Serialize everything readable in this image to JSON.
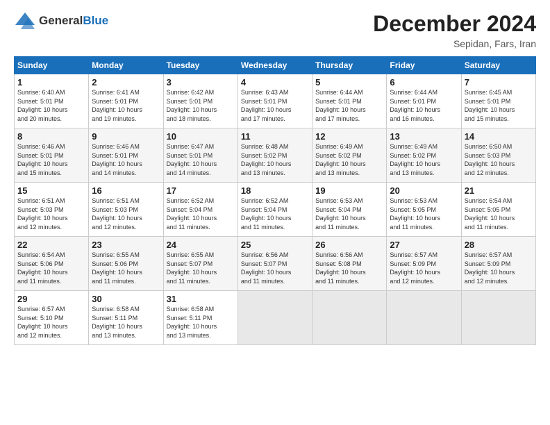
{
  "header": {
    "logo_general": "General",
    "logo_blue": "Blue",
    "month": "December 2024",
    "location": "Sepidan, Fars, Iran"
  },
  "days_of_week": [
    "Sunday",
    "Monday",
    "Tuesday",
    "Wednesday",
    "Thursday",
    "Friday",
    "Saturday"
  ],
  "weeks": [
    [
      {
        "day": "1",
        "info": "Sunrise: 6:40 AM\nSunset: 5:01 PM\nDaylight: 10 hours\nand 20 minutes."
      },
      {
        "day": "2",
        "info": "Sunrise: 6:41 AM\nSunset: 5:01 PM\nDaylight: 10 hours\nand 19 minutes."
      },
      {
        "day": "3",
        "info": "Sunrise: 6:42 AM\nSunset: 5:01 PM\nDaylight: 10 hours\nand 18 minutes."
      },
      {
        "day": "4",
        "info": "Sunrise: 6:43 AM\nSunset: 5:01 PM\nDaylight: 10 hours\nand 17 minutes."
      },
      {
        "day": "5",
        "info": "Sunrise: 6:44 AM\nSunset: 5:01 PM\nDaylight: 10 hours\nand 17 minutes."
      },
      {
        "day": "6",
        "info": "Sunrise: 6:44 AM\nSunset: 5:01 PM\nDaylight: 10 hours\nand 16 minutes."
      },
      {
        "day": "7",
        "info": "Sunrise: 6:45 AM\nSunset: 5:01 PM\nDaylight: 10 hours\nand 15 minutes."
      }
    ],
    [
      {
        "day": "8",
        "info": "Sunrise: 6:46 AM\nSunset: 5:01 PM\nDaylight: 10 hours\nand 15 minutes."
      },
      {
        "day": "9",
        "info": "Sunrise: 6:46 AM\nSunset: 5:01 PM\nDaylight: 10 hours\nand 14 minutes."
      },
      {
        "day": "10",
        "info": "Sunrise: 6:47 AM\nSunset: 5:01 PM\nDaylight: 10 hours\nand 14 minutes."
      },
      {
        "day": "11",
        "info": "Sunrise: 6:48 AM\nSunset: 5:02 PM\nDaylight: 10 hours\nand 13 minutes."
      },
      {
        "day": "12",
        "info": "Sunrise: 6:49 AM\nSunset: 5:02 PM\nDaylight: 10 hours\nand 13 minutes."
      },
      {
        "day": "13",
        "info": "Sunrise: 6:49 AM\nSunset: 5:02 PM\nDaylight: 10 hours\nand 13 minutes."
      },
      {
        "day": "14",
        "info": "Sunrise: 6:50 AM\nSunset: 5:03 PM\nDaylight: 10 hours\nand 12 minutes."
      }
    ],
    [
      {
        "day": "15",
        "info": "Sunrise: 6:51 AM\nSunset: 5:03 PM\nDaylight: 10 hours\nand 12 minutes."
      },
      {
        "day": "16",
        "info": "Sunrise: 6:51 AM\nSunset: 5:03 PM\nDaylight: 10 hours\nand 12 minutes."
      },
      {
        "day": "17",
        "info": "Sunrise: 6:52 AM\nSunset: 5:04 PM\nDaylight: 10 hours\nand 11 minutes."
      },
      {
        "day": "18",
        "info": "Sunrise: 6:52 AM\nSunset: 5:04 PM\nDaylight: 10 hours\nand 11 minutes."
      },
      {
        "day": "19",
        "info": "Sunrise: 6:53 AM\nSunset: 5:04 PM\nDaylight: 10 hours\nand 11 minutes."
      },
      {
        "day": "20",
        "info": "Sunrise: 6:53 AM\nSunset: 5:05 PM\nDaylight: 10 hours\nand 11 minutes."
      },
      {
        "day": "21",
        "info": "Sunrise: 6:54 AM\nSunset: 5:05 PM\nDaylight: 10 hours\nand 11 minutes."
      }
    ],
    [
      {
        "day": "22",
        "info": "Sunrise: 6:54 AM\nSunset: 5:06 PM\nDaylight: 10 hours\nand 11 minutes."
      },
      {
        "day": "23",
        "info": "Sunrise: 6:55 AM\nSunset: 5:06 PM\nDaylight: 10 hours\nand 11 minutes."
      },
      {
        "day": "24",
        "info": "Sunrise: 6:55 AM\nSunset: 5:07 PM\nDaylight: 10 hours\nand 11 minutes."
      },
      {
        "day": "25",
        "info": "Sunrise: 6:56 AM\nSunset: 5:07 PM\nDaylight: 10 hours\nand 11 minutes."
      },
      {
        "day": "26",
        "info": "Sunrise: 6:56 AM\nSunset: 5:08 PM\nDaylight: 10 hours\nand 11 minutes."
      },
      {
        "day": "27",
        "info": "Sunrise: 6:57 AM\nSunset: 5:09 PM\nDaylight: 10 hours\nand 12 minutes."
      },
      {
        "day": "28",
        "info": "Sunrise: 6:57 AM\nSunset: 5:09 PM\nDaylight: 10 hours\nand 12 minutes."
      }
    ],
    [
      {
        "day": "29",
        "info": "Sunrise: 6:57 AM\nSunset: 5:10 PM\nDaylight: 10 hours\nand 12 minutes."
      },
      {
        "day": "30",
        "info": "Sunrise: 6:58 AM\nSunset: 5:11 PM\nDaylight: 10 hours\nand 13 minutes."
      },
      {
        "day": "31",
        "info": "Sunrise: 6:58 AM\nSunset: 5:11 PM\nDaylight: 10 hours\nand 13 minutes."
      },
      {
        "day": "",
        "info": ""
      },
      {
        "day": "",
        "info": ""
      },
      {
        "day": "",
        "info": ""
      },
      {
        "day": "",
        "info": ""
      }
    ]
  ]
}
